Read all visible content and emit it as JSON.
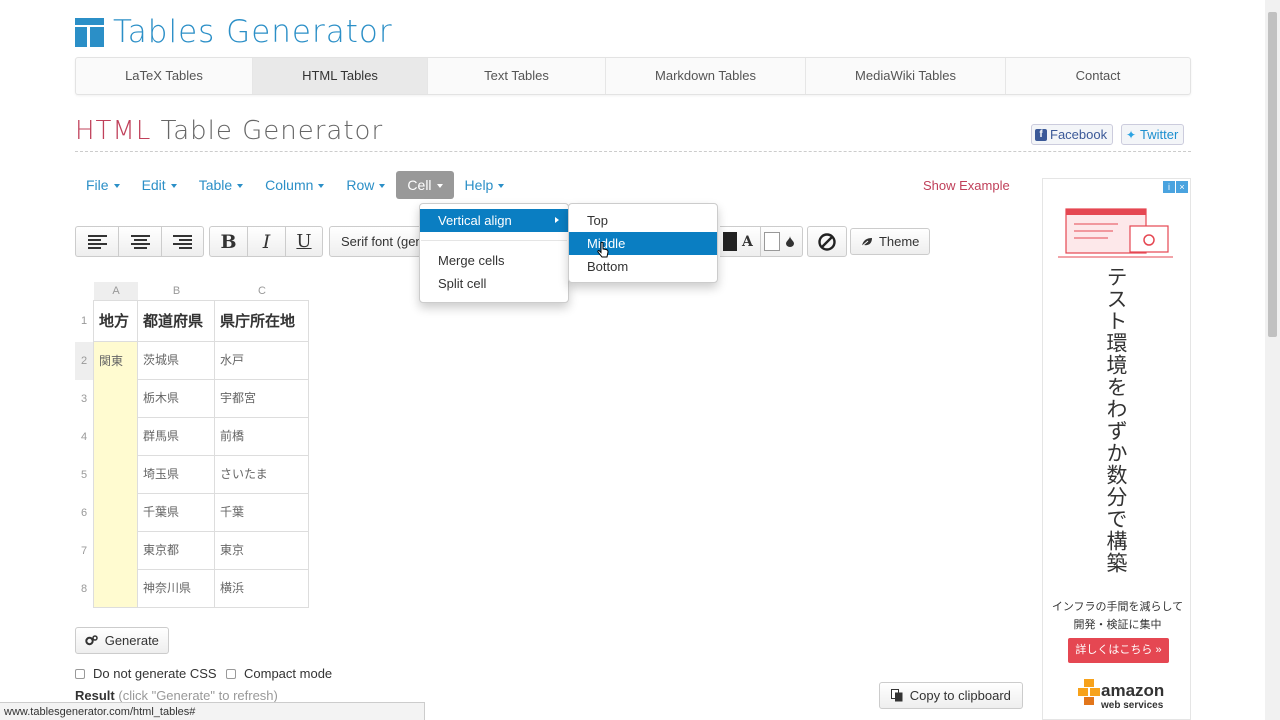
{
  "brand": {
    "name": "Tables Generator"
  },
  "nav": {
    "tabs": [
      {
        "label": "LaTeX Tables",
        "active": false
      },
      {
        "label": "HTML Tables",
        "active": true
      },
      {
        "label": "Text Tables",
        "active": false
      },
      {
        "label": "Markdown Tables",
        "active": false
      },
      {
        "label": "MediaWiki Tables",
        "active": false
      },
      {
        "label": "Contact",
        "active": false
      }
    ]
  },
  "page": {
    "title_accent": "HTML",
    "title_rest": "Table Generator"
  },
  "social": {
    "facebook": "Facebook",
    "twitter": "Twitter"
  },
  "menu": {
    "items": [
      "File",
      "Edit",
      "Table",
      "Column",
      "Row",
      "Cell",
      "Help"
    ],
    "open": "Cell",
    "show_example": "Show Example"
  },
  "cell_menu": {
    "vertical_align": "Vertical align",
    "merge_cells": "Merge cells",
    "split_cell": "Split cell"
  },
  "valign_submenu": {
    "items": [
      "Top",
      "Middle",
      "Bottom"
    ],
    "active": "Middle"
  },
  "toolbar": {
    "bold": "B",
    "italic": "I",
    "underline": "U",
    "font": "Serif font (generic)",
    "text_color_glyph": "A",
    "theme": "Theme"
  },
  "sheet": {
    "col_headers": [
      "A",
      "B",
      "C"
    ],
    "row_numbers": [
      "1",
      "2",
      "3",
      "4",
      "5",
      "6",
      "7",
      "8"
    ],
    "header": [
      "地方",
      "都道府県",
      "県庁所在地"
    ],
    "region": "関東",
    "prefectures": [
      "茨城県",
      "栃木県",
      "群馬県",
      "埼玉県",
      "千葉県",
      "東京都",
      "神奈川県"
    ],
    "capitals": [
      "水戸",
      "宇都宮",
      "前橋",
      "さいたま",
      "千葉",
      "東京",
      "横浜"
    ],
    "merged_fill": "#fffbd0"
  },
  "actions": {
    "generate": "Generate",
    "no_css": "Do not generate CSS",
    "compact": "Compact mode",
    "result": "Result",
    "result_hint": "(click \"Generate\" to refresh)",
    "copy": "Copy to clipboard"
  },
  "status_url": "www.tablesgenerator.com/html_tables#",
  "ad": {
    "headline": "テスト環境をわずか数分で構築",
    "sub1": "インフラの手間を減らして",
    "sub2": "開発・検証に集中",
    "cta": "詳しくはこちら »",
    "aws_name": "amazon",
    "aws_sub": "web services",
    "accent": "#e54752"
  },
  "colors": {
    "brand": "#2b8fc7",
    "accent": "#c0405a",
    "menu_active": "#0a7ec2"
  }
}
